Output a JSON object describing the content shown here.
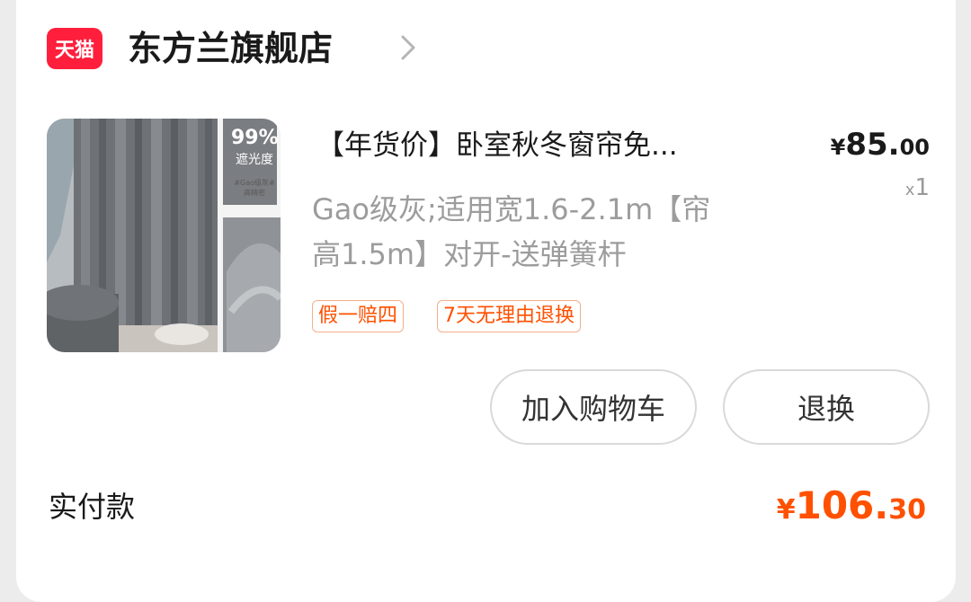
{
  "shop": {
    "badge": "天猫",
    "name": "东方兰旗舰店"
  },
  "product": {
    "image_text": {
      "percent": "99%",
      "blackout": "遮光度",
      "tiny_line1": "#Gao级灰#",
      "tiny_line2": "高精密"
    },
    "title": "【年货价】卧室秋冬窗帘免...",
    "price": {
      "symbol": "¥",
      "integer": "85.",
      "decimal": "00"
    },
    "quantity": {
      "prefix": "x",
      "value": "1"
    },
    "spec_line1": "Gao级灰;适用宽1.6-2.1m【帘",
    "spec_line2": "高1.5m】对开-送弹簧杆",
    "tags": [
      "假一赔四",
      "7天无理由退换"
    ]
  },
  "actions": {
    "add_to_cart": "加入购物车",
    "exchange": "退换"
  },
  "payment": {
    "label": "实付款",
    "symbol": "¥",
    "integer": "106.",
    "decimal": "30"
  },
  "colors": {
    "tmall_red": "#ff1f3d",
    "accent_orange": "#ff5000",
    "tag_border": "#f3b08a"
  }
}
